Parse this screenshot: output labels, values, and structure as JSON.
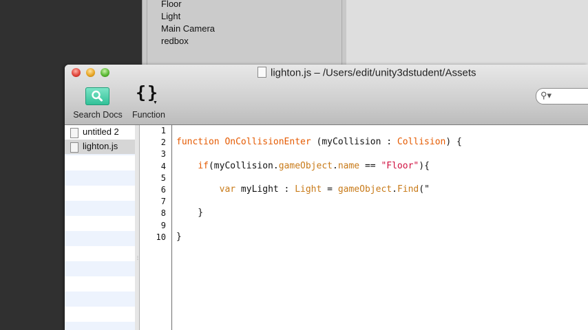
{
  "hierarchy": {
    "items": [
      "Floor",
      "Light",
      "Main Camera",
      "redbox"
    ]
  },
  "window": {
    "title": "lighton.js – /Users/edit/unity3dstudent/Assets"
  },
  "toolbar": {
    "search_docs_label": "Search Docs",
    "function_label": "Function",
    "search_field_value": ""
  },
  "sidebar": {
    "files": [
      {
        "name": "untitled 2",
        "icon": "unsaved-script-icon",
        "selected": false
      },
      {
        "name": "lighton.js",
        "icon": "document-icon",
        "selected": true
      }
    ]
  },
  "editor": {
    "line_numbers": [
      "1",
      "2",
      "3",
      "4",
      "5",
      "6",
      "7",
      "8",
      "9",
      "10"
    ],
    "lines": [
      {
        "num": "1",
        "tokens": []
      },
      {
        "num": "2",
        "tokens": [
          {
            "t": "function",
            "c": "kw"
          },
          {
            "t": " ",
            "c": ""
          },
          {
            "t": "OnCollisionEnter",
            "c": "kw"
          },
          {
            "t": " (myCollision : ",
            "c": ""
          },
          {
            "t": "Collision",
            "c": "kw"
          },
          {
            "t": ") {",
            "c": ""
          }
        ]
      },
      {
        "num": "3",
        "tokens": []
      },
      {
        "num": "4",
        "tokens": [
          {
            "t": "    ",
            "c": ""
          },
          {
            "t": "if",
            "c": "kw"
          },
          {
            "t": "(myCollision.",
            "c": ""
          },
          {
            "t": "gameObject",
            "c": "id"
          },
          {
            "t": ".",
            "c": ""
          },
          {
            "t": "name",
            "c": "id"
          },
          {
            "t": " == ",
            "c": ""
          },
          {
            "t": "\"Floor\"",
            "c": "str"
          },
          {
            "t": "){",
            "c": ""
          }
        ]
      },
      {
        "num": "5",
        "tokens": []
      },
      {
        "num": "6",
        "tokens": [
          {
            "t": "        ",
            "c": ""
          },
          {
            "t": "var",
            "c": "id"
          },
          {
            "t": " myLight : ",
            "c": ""
          },
          {
            "t": "Light",
            "c": "id"
          },
          {
            "t": " = ",
            "c": ""
          },
          {
            "t": "gameObject",
            "c": "id"
          },
          {
            "t": ".",
            "c": ""
          },
          {
            "t": "Find",
            "c": "id"
          },
          {
            "t": "(\"",
            "c": ""
          }
        ]
      },
      {
        "num": "7",
        "tokens": []
      },
      {
        "num": "8",
        "tokens": [
          {
            "t": "    }",
            "c": ""
          }
        ]
      },
      {
        "num": "9",
        "tokens": []
      },
      {
        "num": "10",
        "tokens": [
          {
            "t": "}",
            "c": ""
          }
        ]
      }
    ]
  },
  "colors": {
    "keyword": "#e55a00",
    "identifier": "#c87a18",
    "string": "#d01040",
    "search_docs_accent": "#2fbf96"
  }
}
